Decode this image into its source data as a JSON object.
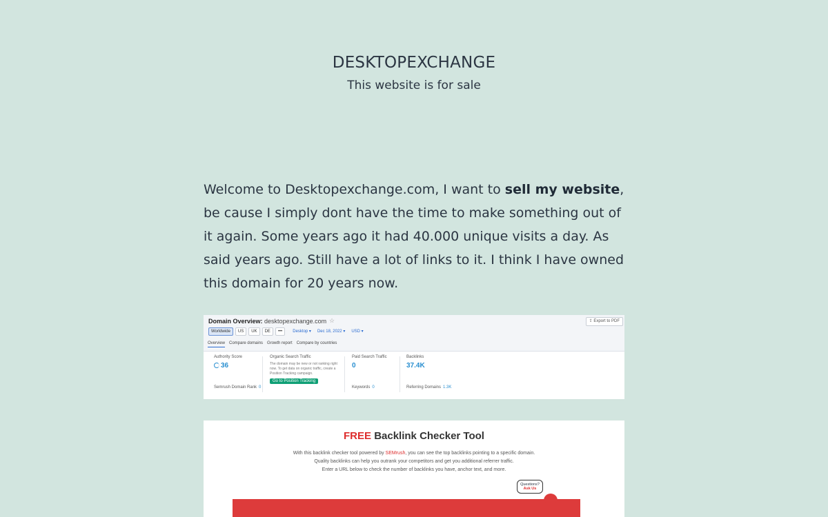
{
  "header": {
    "title": "DESKTOPEXCHANGE",
    "subtitle": "This website is for sale"
  },
  "intro": {
    "before": "Welcome to Desktopexchange.com, I want to ",
    "bold": "sell my website",
    "after": ", be cause I simply dont have the time to make something out of it again. Some years ago it had 40.000 unique visits a day. As said years ago. Still have a lot of links to it. I think I have owned this domain for 20 years now."
  },
  "overview": {
    "title": "Domain Overview:",
    "domain": "desktopexchange.com",
    "export": "Export to PDF",
    "filters": [
      "Worldwide",
      "US",
      "UK",
      "DE",
      "•••"
    ],
    "device": "Desktop",
    "date": "Dec 18, 2022",
    "currency": "USD",
    "tabs": [
      "Overview",
      "Compare domains",
      "Growth report",
      "Compare by countries"
    ],
    "authority_label": "Authority Score",
    "authority_value": "36",
    "rank_label": "Semrush Domain Rank",
    "rank_value": "0",
    "organic_label": "Organic Search Traffic",
    "organic_desc": "The domain may be new or not ranking right now. To get data on organic traffic, create a Position Tracking campaign.",
    "organic_button": "Go to Position Tracking",
    "paid_label": "Paid Search Traffic",
    "paid_value": "0",
    "keywords_label": "Keywords",
    "keywords_value": "0",
    "backlinks_label": "Backlinks",
    "backlinks_value": "37.4K",
    "referring_label": "Referring Domains",
    "referring_value": "1.3K"
  },
  "checker": {
    "free": "FREE",
    "title": " Backlink Checker Tool",
    "line1a": "With this backlink checker tool powered by ",
    "line1b": "SEMrush",
    "line1c": ", you can see the top backlinks pointing to a specific domain.",
    "line2": "Quality backlinks can help you outrank your competitors and get you additional referrer traffic.",
    "line3": "Enter a URL below to check the number of backlinks you have, anchor text, and more.",
    "bubble1": "Questions?",
    "bubble2": "Ask Us"
  }
}
